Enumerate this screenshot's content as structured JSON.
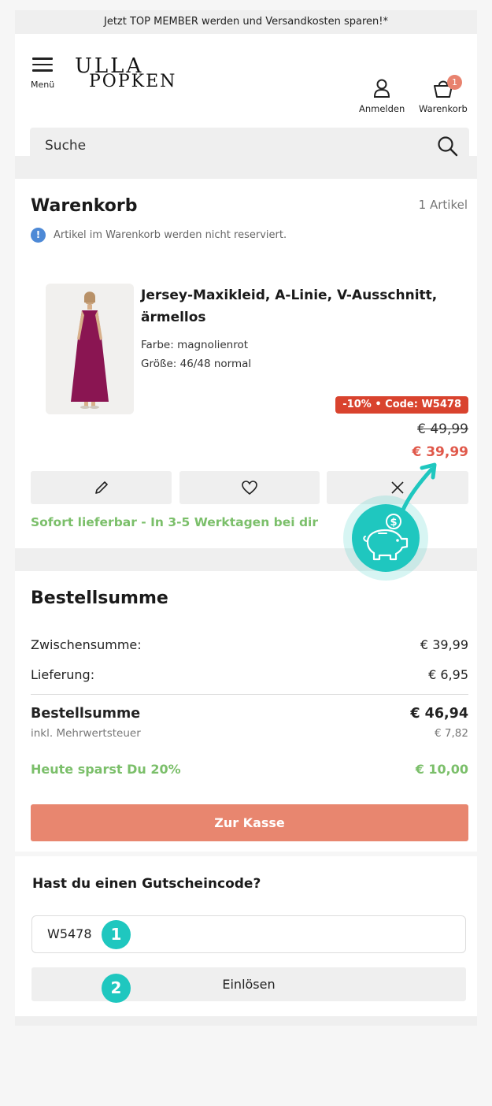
{
  "promo_bar": "Jetzt TOP MEMBER werden und Versandkosten sparen!*",
  "header": {
    "menu_label": "Menü",
    "logo_line1": "ULLA",
    "logo_line2": "POPKEN",
    "login_label": "Anmelden",
    "cart_label": "Warenkorb",
    "cart_count": "1"
  },
  "search": {
    "placeholder": "Suche"
  },
  "cart": {
    "title": "Warenkorb",
    "count": "1 Artikel",
    "notice": "Artikel im Warenkorb werden nicht reserviert.",
    "item": {
      "name": "Jersey-Maxikleid, A-Linie, V-Ausschnitt, ärmellos",
      "color": "Farbe: magnolienrot",
      "size": "Größe: 46/48 normal",
      "coupon_badge": "-10% • Code: W5478",
      "old_price": "€ 49,99",
      "new_price": "€ 39,99",
      "availability": "Sofort lieferbar - In 3-5 Werktagen bei dir"
    }
  },
  "summary": {
    "title": "Bestellsumme",
    "subtotal_label": "Zwischensumme:",
    "subtotal_value": "€ 39,99",
    "shipping_label": "Lieferung:",
    "shipping_value": "€ 6,95",
    "total_label": "Bestellsumme",
    "total_value": "€ 46,94",
    "vat_label": "inkl. Mehrwertsteuer",
    "vat_value": "€ 7,82",
    "savings_label": "Heute sparst Du 20%",
    "savings_value": "€ 10,00",
    "checkout_label": "Zur Kasse"
  },
  "voucher": {
    "title": "Hast du einen Gutscheincode?",
    "code_value": "W5478",
    "redeem_label": "Einlösen",
    "step1": "1",
    "step2": "2"
  },
  "colors": {
    "accent_teal": "#1fc7bf",
    "coupon_red": "#d9432e",
    "price_red": "#e0584a",
    "green": "#7bbf6a",
    "checkout": "#e8866f",
    "badge": "#e8826e"
  }
}
